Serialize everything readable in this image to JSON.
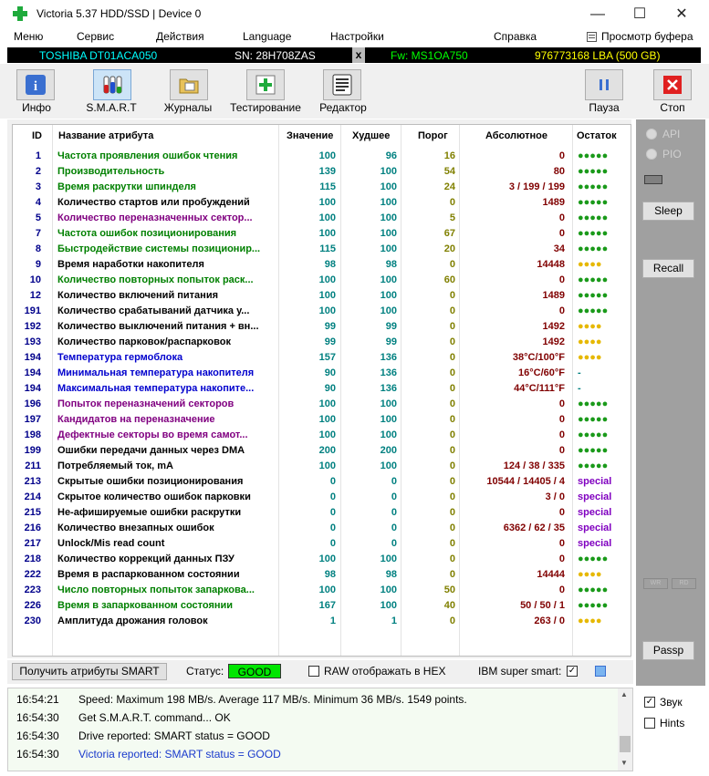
{
  "window": {
    "title": "Victoria 5.37 HDD/SSD | Device 0",
    "minimize": "—",
    "maximize": "☐",
    "close": "✕"
  },
  "menu": {
    "items": [
      "Меню",
      "Сервис",
      "Действия",
      "Language",
      "Настройки",
      "Справка"
    ],
    "buffer_view": "Просмотр буфера"
  },
  "drive": {
    "model": "TOSHIBA DT01ACA050",
    "serial": "SN: 28H708ZAS",
    "x": "x",
    "firmware": "Fw: MS1OA750",
    "capacity": "976773168 LBA (500 GB)"
  },
  "toolbar": {
    "info": "Инфо",
    "smart": "S.M.A.R.T",
    "logs": "Журналы",
    "testing": "Тестирование",
    "editor": "Редактор",
    "pause": "Пауза",
    "stop": "Стоп"
  },
  "table": {
    "headers": {
      "id": "ID",
      "name": "Название атрибута",
      "value": "Значение",
      "worst": "Худшее",
      "threshold": "Порог",
      "raw": "Абсолютное",
      "remaining": "Остаток"
    },
    "rows": [
      {
        "id": "1",
        "name": "Частота проявления ошибок чтения",
        "value": "100",
        "worst": "96",
        "thr": "16",
        "raw": "0",
        "rem": "●●●●●",
        "remType": "g",
        "color": "#008000"
      },
      {
        "id": "2",
        "name": "Производительность",
        "value": "139",
        "worst": "100",
        "thr": "54",
        "raw": "80",
        "rem": "●●●●●",
        "remType": "g",
        "color": "#008000"
      },
      {
        "id": "3",
        "name": "Время раскрутки шпинделя",
        "value": "115",
        "worst": "100",
        "thr": "24",
        "raw": "3 / 199 / 199",
        "rem": "●●●●●",
        "remType": "g",
        "color": "#008000"
      },
      {
        "id": "4",
        "name": "Количество стартов или пробуждений",
        "value": "100",
        "worst": "100",
        "thr": "0",
        "raw": "1489",
        "rem": "●●●●●",
        "remType": "g",
        "color": "#000000"
      },
      {
        "id": "5",
        "name": "Количество переназначенных сектор...",
        "value": "100",
        "worst": "100",
        "thr": "5",
        "raw": "0",
        "rem": "●●●●●",
        "remType": "g",
        "color": "#800080"
      },
      {
        "id": "7",
        "name": "Частота ошибок позиционирования",
        "value": "100",
        "worst": "100",
        "thr": "67",
        "raw": "0",
        "rem": "●●●●●",
        "remType": "g",
        "color": "#008000"
      },
      {
        "id": "8",
        "name": "Быстродействие системы позиционир...",
        "value": "115",
        "worst": "100",
        "thr": "20",
        "raw": "34",
        "rem": "●●●●●",
        "remType": "g",
        "color": "#008000"
      },
      {
        "id": "9",
        "name": "Время наработки накопителя",
        "value": "98",
        "worst": "98",
        "thr": "0",
        "raw": "14448",
        "rem": "●●●●",
        "remType": "y",
        "color": "#000000"
      },
      {
        "id": "10",
        "name": "Количество повторных попыток раск...",
        "value": "100",
        "worst": "100",
        "thr": "60",
        "raw": "0",
        "rem": "●●●●●",
        "remType": "g",
        "color": "#008000"
      },
      {
        "id": "12",
        "name": "Количество включений питания",
        "value": "100",
        "worst": "100",
        "thr": "0",
        "raw": "1489",
        "rem": "●●●●●",
        "remType": "g",
        "color": "#000000"
      },
      {
        "id": "191",
        "name": "Количество срабатываний датчика у...",
        "value": "100",
        "worst": "100",
        "thr": "0",
        "raw": "0",
        "rem": "●●●●●",
        "remType": "g",
        "color": "#000000"
      },
      {
        "id": "192",
        "name": "Количество выключений питания + вн...",
        "value": "99",
        "worst": "99",
        "thr": "0",
        "raw": "1492",
        "rem": "●●●●",
        "remType": "y",
        "color": "#000000"
      },
      {
        "id": "193",
        "name": "Количество парковок/распарковок",
        "value": "99",
        "worst": "99",
        "thr": "0",
        "raw": "1492",
        "rem": "●●●●",
        "remType": "y",
        "color": "#000000"
      },
      {
        "id": "194",
        "name": "Температура гермоблока",
        "value": "157",
        "worst": "136",
        "thr": "0",
        "raw": "38°C/100°F",
        "rem": "●●●●",
        "remType": "y",
        "color": "#0000cd"
      },
      {
        "id": "194",
        "name": "Минимальная температура накопителя",
        "value": "90",
        "worst": "136",
        "thr": "0",
        "raw": "16°C/60°F",
        "rem": "-",
        "remType": "d",
        "color": "#0000cd"
      },
      {
        "id": "194",
        "name": "Максимальная температура накопите...",
        "value": "90",
        "worst": "136",
        "thr": "0",
        "raw": "44°C/111°F",
        "rem": "-",
        "remType": "d",
        "color": "#0000cd"
      },
      {
        "id": "196",
        "name": "Попыток переназначений секторов",
        "value": "100",
        "worst": "100",
        "thr": "0",
        "raw": "0",
        "rem": "●●●●●",
        "remType": "g",
        "color": "#800080"
      },
      {
        "id": "197",
        "name": "Кандидатов на переназначение",
        "value": "100",
        "worst": "100",
        "thr": "0",
        "raw": "0",
        "rem": "●●●●●",
        "remType": "g",
        "color": "#800080"
      },
      {
        "id": "198",
        "name": "Дефектные секторы во время самот...",
        "value": "100",
        "worst": "100",
        "thr": "0",
        "raw": "0",
        "rem": "●●●●●",
        "remType": "g",
        "color": "#800080"
      },
      {
        "id": "199",
        "name": "Ошибки передачи данных через DMA",
        "value": "200",
        "worst": "200",
        "thr": "0",
        "raw": "0",
        "rem": "●●●●●",
        "remType": "g",
        "color": "#000000"
      },
      {
        "id": "211",
        "name": "Потребляемый ток, mA",
        "value": "100",
        "worst": "100",
        "thr": "0",
        "raw": "124 / 38 / 335",
        "rem": "●●●●●",
        "remType": "g",
        "color": "#000000"
      },
      {
        "id": "213",
        "name": "Скрытые ошибки позиционирования",
        "value": "0",
        "worst": "0",
        "thr": "0",
        "raw": "10544 / 14405 / 4",
        "rem": "special",
        "remType": "s",
        "color": "#000000"
      },
      {
        "id": "214",
        "name": "Скрытое количество ошибок парковки",
        "value": "0",
        "worst": "0",
        "thr": "0",
        "raw": "3 / 0",
        "rem": "special",
        "remType": "s",
        "color": "#000000"
      },
      {
        "id": "215",
        "name": "Не-афишируемые ошибки раскрутки",
        "value": "0",
        "worst": "0",
        "thr": "0",
        "raw": "0",
        "rem": "special",
        "remType": "s",
        "color": "#000000"
      },
      {
        "id": "216",
        "name": "Количество внезапных ошибок",
        "value": "0",
        "worst": "0",
        "thr": "0",
        "raw": "6362 / 62 / 35",
        "rem": "special",
        "remType": "s",
        "color": "#000000"
      },
      {
        "id": "217",
        "name": "Unlock/Mis read count",
        "value": "0",
        "worst": "0",
        "thr": "0",
        "raw": "0",
        "rem": "special",
        "remType": "s",
        "color": "#000000"
      },
      {
        "id": "218",
        "name": "Количество коррекций данных ПЗУ",
        "value": "100",
        "worst": "100",
        "thr": "0",
        "raw": "0",
        "rem": "●●●●●",
        "remType": "g",
        "color": "#000000"
      },
      {
        "id": "222",
        "name": "Время в распаркованном состоянии",
        "value": "98",
        "worst": "98",
        "thr": "0",
        "raw": "14444",
        "rem": "●●●●",
        "remType": "y",
        "color": "#000000"
      },
      {
        "id": "223",
        "name": "Число повторных попыток запаркова...",
        "value": "100",
        "worst": "100",
        "thr": "50",
        "raw": "0",
        "rem": "●●●●●",
        "remType": "g",
        "color": "#008000"
      },
      {
        "id": "226",
        "name": "Время в запаркованном состоянии",
        "value": "167",
        "worst": "100",
        "thr": "40",
        "raw": "50 / 50 / 1",
        "rem": "●●●●●",
        "remType": "g",
        "color": "#008000"
      },
      {
        "id": "230",
        "name": "Амплитуда дрожания головок",
        "value": "1",
        "worst": "1",
        "thr": "0",
        "raw": "263 / 0",
        "rem": "●●●●",
        "remType": "y",
        "color": "#000000"
      }
    ]
  },
  "right_panel": {
    "api": "API",
    "pio": "PIO",
    "sleep": "Sleep",
    "recall": "Recall",
    "wr": "WR",
    "rd": "RD",
    "passp": "Passp",
    "sound": "Звук",
    "hints": "Hints"
  },
  "status_bar": {
    "get_smart": "Получить атрибуты SMART",
    "status_label": "Статус:",
    "status_value": "GOOD",
    "raw_hex": "RAW отображать в HEX",
    "ibm": "IBM super smart:"
  },
  "log": [
    {
      "time": "16:54:21",
      "msg": "Speed: Maximum 198 MB/s. Average 117 MB/s. Minimum 36 MB/s. 1549 points.",
      "color": "#000000"
    },
    {
      "time": "16:54:30",
      "msg": "Get S.M.A.R.T. command... OK",
      "color": "#000000"
    },
    {
      "time": "16:54:30",
      "msg": "Drive reported: SMART status = GOOD",
      "color": "#000000"
    },
    {
      "time": "16:54:30",
      "msg": "Victoria reported: SMART status = GOOD",
      "color": "#1a3acc"
    }
  ],
  "colors": {
    "good": "#00e600",
    "dot_green": "#1a9a1a",
    "dot_yellow": "#e6b800",
    "special": "#8000c0"
  }
}
